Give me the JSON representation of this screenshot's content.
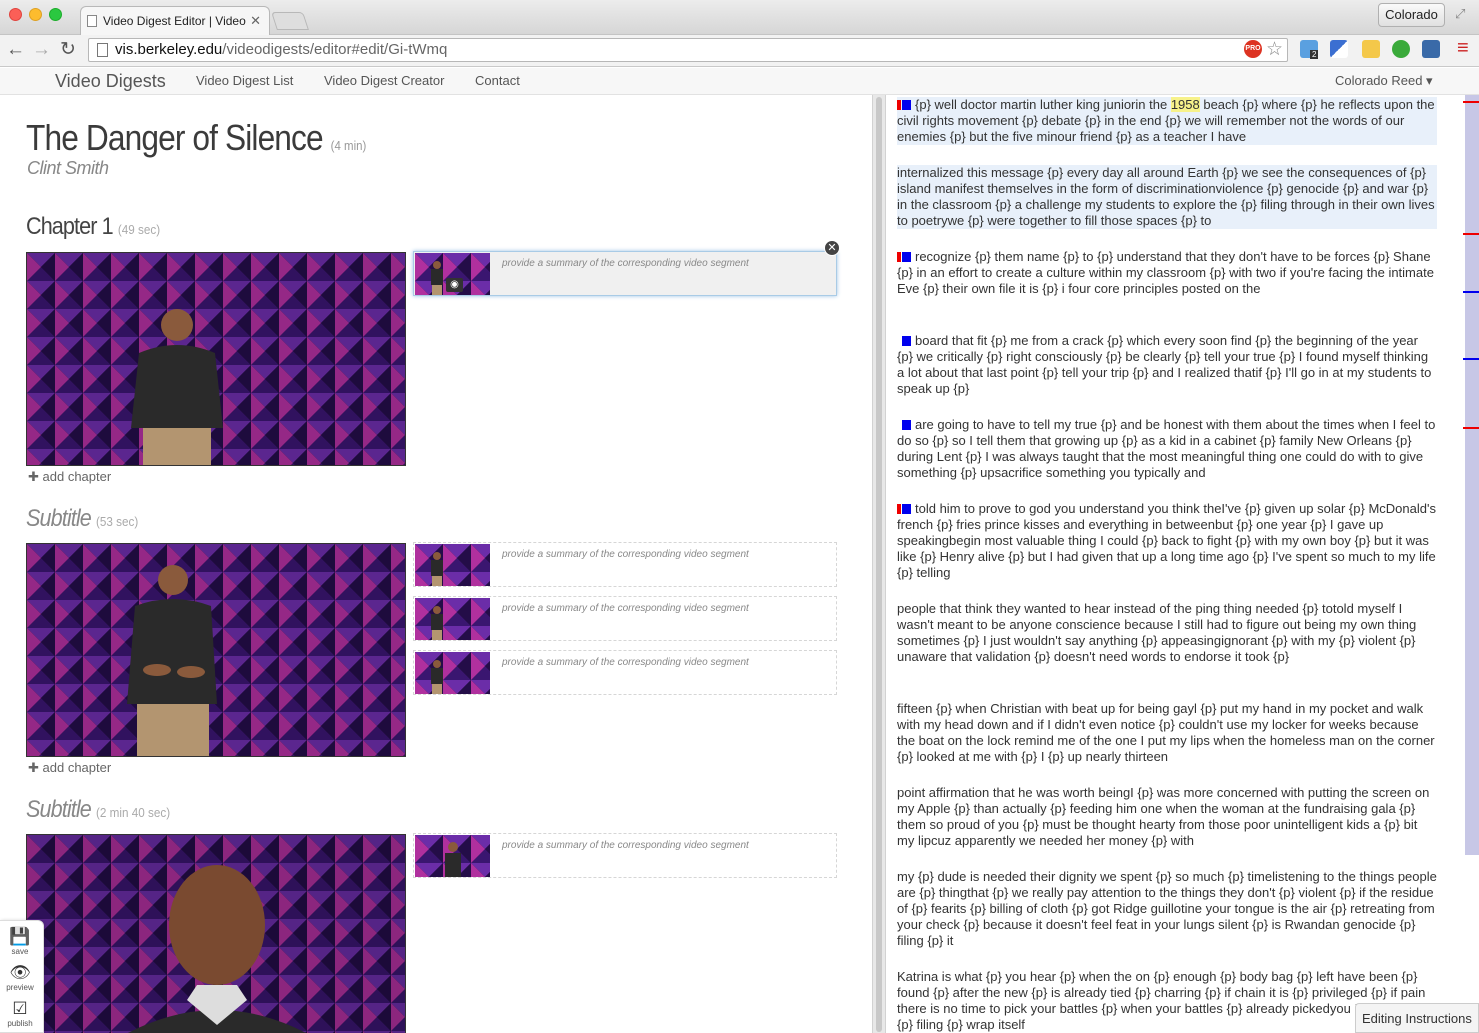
{
  "browser": {
    "tab_title": "Video Digest Editor | Video",
    "profile": "Colorado",
    "url_host": "vis.berkeley.edu",
    "url_path": "/videodigests/editor#edit/Gi-tWmq",
    "pro_badge": "PRO",
    "ext_badge": "2",
    "icons": [
      "back-icon",
      "forward-icon",
      "reload-icon",
      "star-icon",
      "menu-icon"
    ]
  },
  "nav": {
    "brand": "Video Digests",
    "links": [
      "Video Digest List",
      "Video Digest Creator",
      "Contact"
    ],
    "user": "Colorado Reed ▾"
  },
  "digest": {
    "title": "The Danger of Silence",
    "duration": "(4 min)",
    "speaker": "Clint Smith"
  },
  "sections": [
    {
      "heading": "Chapter 1",
      "duration": "(49 sec)",
      "type": "chapter"
    },
    {
      "heading": "Subtitle",
      "duration": "(53 sec)",
      "type": "subtitle"
    },
    {
      "heading": "Subtitle",
      "duration": "(2 min 40 sec)",
      "type": "subtitle"
    }
  ],
  "add_chapter_label": "add chapter",
  "segment_placeholder": "provide a summary of the corresponding video segment",
  "actions": {
    "save": "save",
    "preview": "preview",
    "publish": "publish"
  },
  "transcript": [
    {
      "pre": "{p} well doctor martin luther king juniorin the ",
      "kw": "1958",
      "post": " beach {p} where {p} he reflects upon the civil rights movement {p} debate {p} in the end {p} we will remember not the words of our enemies {p} but the five minour friend {p} as a teacher I have"
    },
    {
      "pre": "internalized this message {p} every day all around Earth {p} we see the consequences of {p} island manifest themselves in the form of discriminationviolence {p} genocide {p} and war {p} in the classroom {p} a challenge my students to explore the {p} filing through in their own lives to poetrywe {p} were together to fill those spaces {p} to"
    },
    {
      "pre": "recognize {p} them name {p} to {p} understand that they don't have to be forces {p} Shane {p} in an effort to create a culture within my classroom {p} with two if you're facing the intimate Eve {p} their own file it is {p} i four core principles posted on the"
    },
    {
      "pre": "board that fit {p} me from a crack {p} which every soon find {p} the beginning of the year {p} we critically {p} right consciously {p} be clearly {p} tell your true {p} I found myself thinking a lot about that last point {p} tell your trip {p} and I realized thatif {p} I'll go in at my students to speak up {p}"
    },
    {
      "pre": "are going to have to tell my true {p} and be honest with them about the times when I feel to do so {p} so I tell them that growing up {p} as a kid in a cabinet {p} family New Orleans {p} during Lent {p} I was always taught that the most meaningful thing one could do with to give something {p} upsacrifice something you typically and"
    },
    {
      "pre": "told him to prove to god you understand you think theI've {p} given up solar {p} McDonald's french {p} fries prince kisses and everything in betweenbut {p} one year {p} I gave up speakingbegin most valuable thing I could {p} back to fight {p} with my own boy {p} but it was like {p} Henry alive {p} but I had given that up a long time ago {p} I've spent so much to my life {p} telling"
    },
    {
      "pre": "people that think they wanted to hear instead of the ping thing needed {p} totold myself I wasn't meant to be anyone conscience because I still had to figure out being my own thing sometimes {p} I just wouldn't say anything {p} appeasingignorant {p} with my {p} violent {p} unaware that validation {p} doesn't need words to endorse it took {p}"
    },
    {
      "pre": "fifteen {p} when Christian with beat up for being gayl {p} put my hand in my pocket and walk with my head down and if I didn't even notice {p} couldn't use my locker for weeks because the boat on the lock remind me of the one I put my lips when the homeless man on the corner {p} looked at me with {p} I {p} up nearly thirteen"
    },
    {
      "pre": "point affirmation that he was worth beingI {p} was more concerned with putting the screen on my Apple {p} than actually {p} feeding him one when the woman at the fundraising gala {p} them so proud of you {p} must be thought hearty from those poor unintelligent kids a {p} bit my lipcuz apparently we needed her money {p} with"
    },
    {
      "pre": "my {p} dude is needed their dignity we spent {p} so much {p} timelistening to the things people are {p} thingthat {p} we really pay attention to the things they don't {p} violent {p} if the residue of {p} fearits {p} billing of cloth {p} got Ridge guillotine your tongue is the air {p} retreating from your check {p} because it doesn't feel feat in your lungs silent {p} is Rwandan genocide {p} filing {p} it"
    },
    {
      "pre": "Katrina is what {p} you hear {p} when the on {p} enough {p} body bag {p} left have been {p} found {p} after the new {p} is already tied {p} charring {p} if chain it is {p} privileged {p} if pain there is no time to pick your battles {p} when your battles {p} already pickedyou I will not make {p} filing {p} wrap itself"
    }
  ],
  "editing_instructions": "Editing Instructions"
}
